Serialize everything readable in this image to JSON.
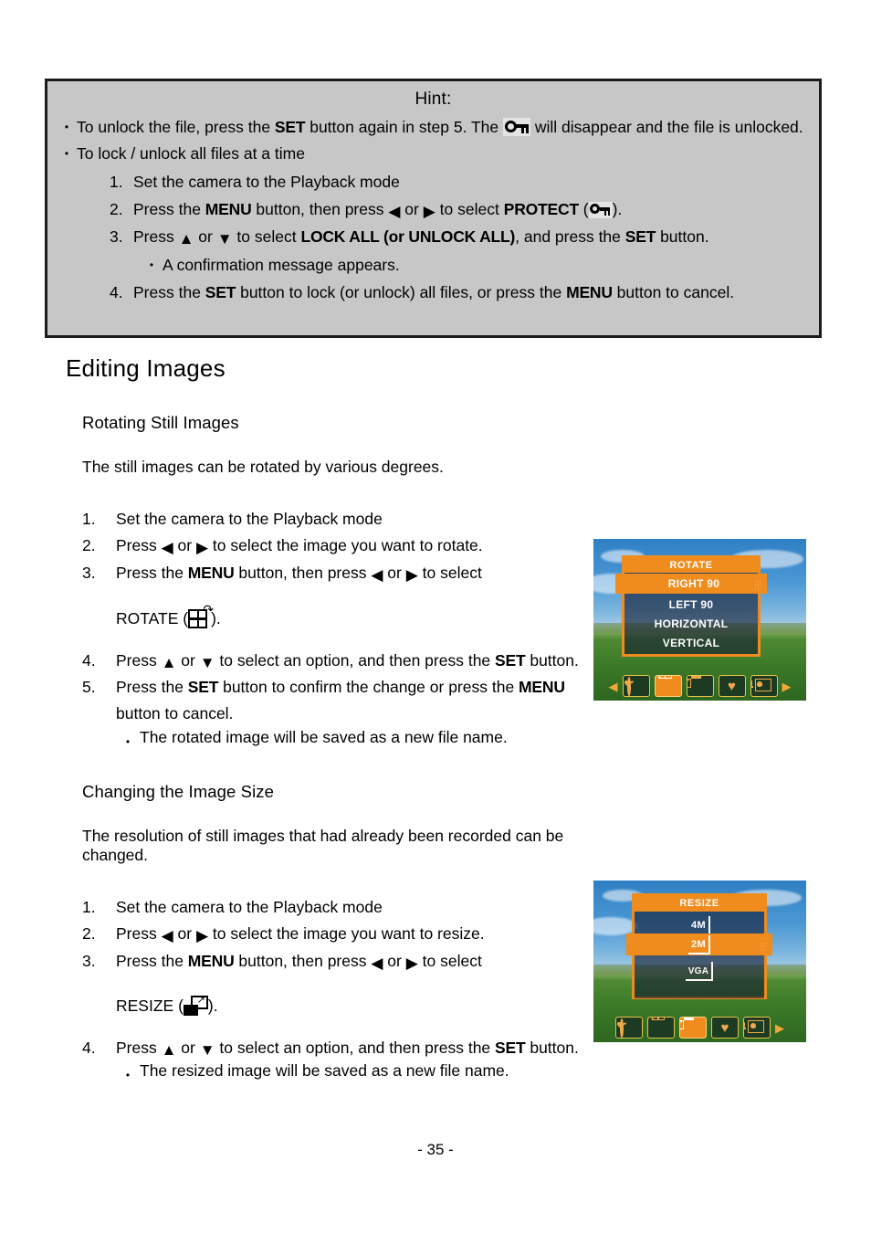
{
  "hint": {
    "title": "Hint:",
    "bullet1_a": "To unlock the file, press the ",
    "bullet1_set": "SET",
    "bullet1_b": " button again in step 5. The ",
    "bullet1_c": " will disappear and the file is unlocked.",
    "bullet2": "To lock / unlock all files at a time",
    "steps": [
      {
        "num": "1.",
        "text": "Set the camera to the Playback mode"
      },
      {
        "num": "2.",
        "text": "Press the MENU button, then press ◀ or ▶ to select PROTECT (⚿)."
      },
      {
        "num": "3.",
        "text": "Press ▲ or ▼ to select LOCK ALL (or UNLOCK ALL), and press the SET button."
      },
      {
        "num": "4.",
        "text": "Press the SET button to lock (or unlock) all files, or press the MENU button to cancel."
      }
    ],
    "step2_parts": {
      "a": "Press the ",
      "menu": "MENU",
      "b": " button, then press ",
      "c": " or ",
      "d": " to select ",
      "protect": "PROTECT",
      "e": ")."
    },
    "step3_parts": {
      "a": "Press ",
      "b": " or ",
      "c": " to select ",
      "lockall": "LOCK ALL (or UNLOCK ALL)",
      "d": ", and press the ",
      "set": "SET",
      "e": " button."
    },
    "step3_sub": "A confirmation message appears.",
    "step4_parts": {
      "a": "Press the ",
      "set": "SET",
      "b": " button to lock (or unlock) all files, or press the ",
      "menu": "MENU",
      "c": " button to cancel."
    }
  },
  "heading": "Editing Images",
  "rotate_section": {
    "title": "Rotating Still Images",
    "intro": "The still images can be rotated by various degrees.",
    "steps": {
      "n1": "1.",
      "t1": "Set the camera to the Playback mode",
      "n2": "2.",
      "t2_a": "Press ",
      "t2_b": " or ",
      "t2_c": " to select the image you want to rotate.",
      "n3": "3.",
      "t3_a": "Press the ",
      "t3_menu": "MENU",
      "t3_b": " button, then press ",
      "t3_c": " or ",
      "t3_d": " to select",
      "t3_label": "ROTATE (",
      "t3_end": ").",
      "n4": "4.",
      "t4_a": "Press ",
      "t4_b": " or ",
      "t4_c": " to select an option, and then press the ",
      "t4_set": "SET",
      "t4_d": " button.",
      "n5": "5.",
      "t5_a": "Press the ",
      "t5_set": "SET",
      "t5_b": " button to confirm the change or press the ",
      "t5_menu": "MENU",
      "t5_c": " button to cancel.",
      "t5_sub": "The rotated image will be saved as a new file name."
    }
  },
  "resize_section": {
    "title": "Changing the Image Size",
    "intro": "The resolution of still images that had already been recorded can be changed.",
    "steps": {
      "n1": "1.",
      "t1": "Set the camera to the Playback mode",
      "n2": "2.",
      "t2_a": "Press ",
      "t2_b": " or ",
      "t2_c": " to select the image you want to resize.",
      "n3": "3.",
      "t3_a": "Press the ",
      "t3_menu": "MENU",
      "t3_b": " button, then press ",
      "t3_c": " or ",
      "t3_d": " to select",
      "t3_label": "RESIZE (",
      "t3_end": ").",
      "n4": "4.",
      "t4_a": "Press ",
      "t4_b": " or ",
      "t4_c": " to select an option, and then press the ",
      "t4_set": "SET",
      "t4_d": " button.",
      "t4_sub": "The resized image will be saved as a new file name."
    }
  },
  "lcd_rotate": {
    "menu_title": "ROTATE",
    "items": [
      "RIGHT 90",
      "LEFT 90",
      "HORIZONTAL",
      "VERTICAL"
    ],
    "selected_index": 0,
    "iconbar": [
      {
        "name": "effect-icon",
        "selected": false
      },
      {
        "name": "rotate-icon",
        "selected": true
      },
      {
        "name": "resize-icon",
        "selected": false
      },
      {
        "name": "favorite-heart-icon",
        "selected": false
      },
      {
        "name": "voice-memo-icon",
        "selected": false
      }
    ],
    "nav_left": "◀",
    "nav_right": "▶"
  },
  "lcd_resize": {
    "menu_title": "RESIZE",
    "items": [
      "4M",
      "2M",
      "VGA"
    ],
    "selected_index": 1,
    "iconbar": [
      {
        "name": "effect-icon",
        "selected": false
      },
      {
        "name": "rotate-icon",
        "selected": false
      },
      {
        "name": "resize-icon",
        "selected": true
      },
      {
        "name": "favorite-heart-icon",
        "selected": false
      },
      {
        "name": "voice-memo-icon",
        "selected": false
      }
    ],
    "nav_right": "▶"
  },
  "glyphs": {
    "left_triangle": "◀",
    "right_triangle": "▶",
    "up_triangle": "▲",
    "down_triangle": "▼",
    "bullet": "•",
    "heart": "♥",
    "rotate_arrow": "↷",
    "resize_arrow": "↗"
  },
  "colors": {
    "hint_bg": "#c7c7c7",
    "hint_border": "#1c1c1c",
    "menu_orange": "#f08c1e",
    "menu_panel_dark": "rgba(20,28,48,.62)",
    "icon_gold": "#e8c34a"
  },
  "page_number": "- 35 -"
}
